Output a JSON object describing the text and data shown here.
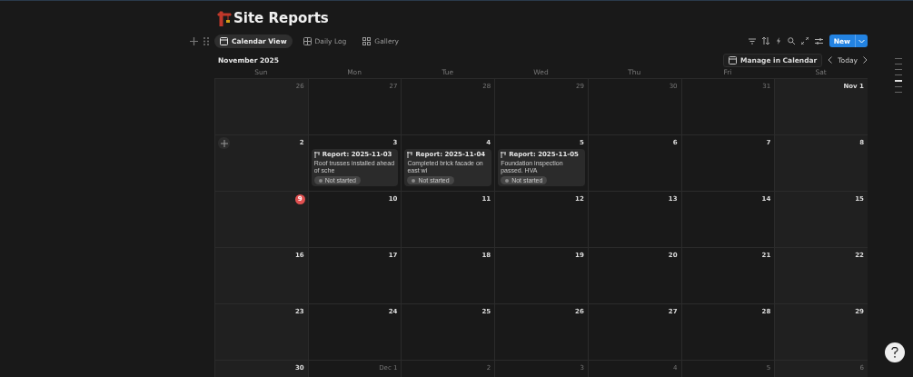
{
  "title": "Site Reports",
  "views": [
    {
      "label": "Calendar View",
      "kind": "calendar",
      "selected": true
    },
    {
      "label": "Daily Log",
      "kind": "table",
      "selected": false
    },
    {
      "label": "Gallery",
      "kind": "gallery",
      "selected": false
    }
  ],
  "new_button": "New",
  "month": "November 2025",
  "manage_button": "Manage in Calendar",
  "today_button": "Today",
  "weekdays": [
    "Sun",
    "Mon",
    "Tue",
    "Wed",
    "Thu",
    "Fri",
    "Sat"
  ],
  "weeks": [
    [
      {
        "label": "26",
        "in_month": false,
        "today": false
      },
      {
        "label": "27",
        "in_month": false,
        "today": false
      },
      {
        "label": "28",
        "in_month": false,
        "today": false
      },
      {
        "label": "29",
        "in_month": false,
        "today": false
      },
      {
        "label": "30",
        "in_month": false,
        "today": false
      },
      {
        "label": "31",
        "in_month": false,
        "today": false
      },
      {
        "label": "Nov 1",
        "in_month": true,
        "today": false
      }
    ],
    [
      {
        "label": "2",
        "in_month": true,
        "today": false
      },
      {
        "label": "3",
        "in_month": true,
        "today": false,
        "events": [
          {
            "title": "Report: 2025-11-03",
            "snippet": "Roof trusses installed ahead of sche",
            "status": "Not started"
          }
        ]
      },
      {
        "label": "4",
        "in_month": true,
        "today": false,
        "events": [
          {
            "title": "Report: 2025-11-04",
            "snippet": "Completed brick facade on east wi",
            "status": "Not started"
          }
        ]
      },
      {
        "label": "5",
        "in_month": true,
        "today": false,
        "events": [
          {
            "title": "Report: 2025-11-05",
            "snippet": "Foundation inspection passed. HVA",
            "status": "Not started"
          }
        ]
      },
      {
        "label": "6",
        "in_month": true,
        "today": false
      },
      {
        "label": "7",
        "in_month": true,
        "today": false
      },
      {
        "label": "8",
        "in_month": true,
        "today": false
      }
    ],
    [
      {
        "label": "9",
        "in_month": true,
        "today": true
      },
      {
        "label": "10",
        "in_month": true,
        "today": false
      },
      {
        "label": "11",
        "in_month": true,
        "today": false
      },
      {
        "label": "12",
        "in_month": true,
        "today": false
      },
      {
        "label": "13",
        "in_month": true,
        "today": false
      },
      {
        "label": "14",
        "in_month": true,
        "today": false
      },
      {
        "label": "15",
        "in_month": true,
        "today": false
      }
    ],
    [
      {
        "label": "16",
        "in_month": true,
        "today": false
      },
      {
        "label": "17",
        "in_month": true,
        "today": false
      },
      {
        "label": "18",
        "in_month": true,
        "today": false
      },
      {
        "label": "19",
        "in_month": true,
        "today": false
      },
      {
        "label": "20",
        "in_month": true,
        "today": false
      },
      {
        "label": "21",
        "in_month": true,
        "today": false
      },
      {
        "label": "22",
        "in_month": true,
        "today": false
      }
    ],
    [
      {
        "label": "23",
        "in_month": true,
        "today": false
      },
      {
        "label": "24",
        "in_month": true,
        "today": false
      },
      {
        "label": "25",
        "in_month": true,
        "today": false
      },
      {
        "label": "26",
        "in_month": true,
        "today": false
      },
      {
        "label": "27",
        "in_month": true,
        "today": false
      },
      {
        "label": "28",
        "in_month": true,
        "today": false
      },
      {
        "label": "29",
        "in_month": true,
        "today": false
      }
    ],
    [
      {
        "label": "30",
        "in_month": true,
        "today": false
      },
      {
        "label": "Dec 1",
        "in_month": false,
        "today": false
      },
      {
        "label": "2",
        "in_month": false,
        "today": false
      },
      {
        "label": "3",
        "in_month": false,
        "today": false
      },
      {
        "label": "4",
        "in_month": false,
        "today": false
      },
      {
        "label": "5",
        "in_month": false,
        "today": false
      },
      {
        "label": "6",
        "in_month": false,
        "today": false
      }
    ]
  ]
}
